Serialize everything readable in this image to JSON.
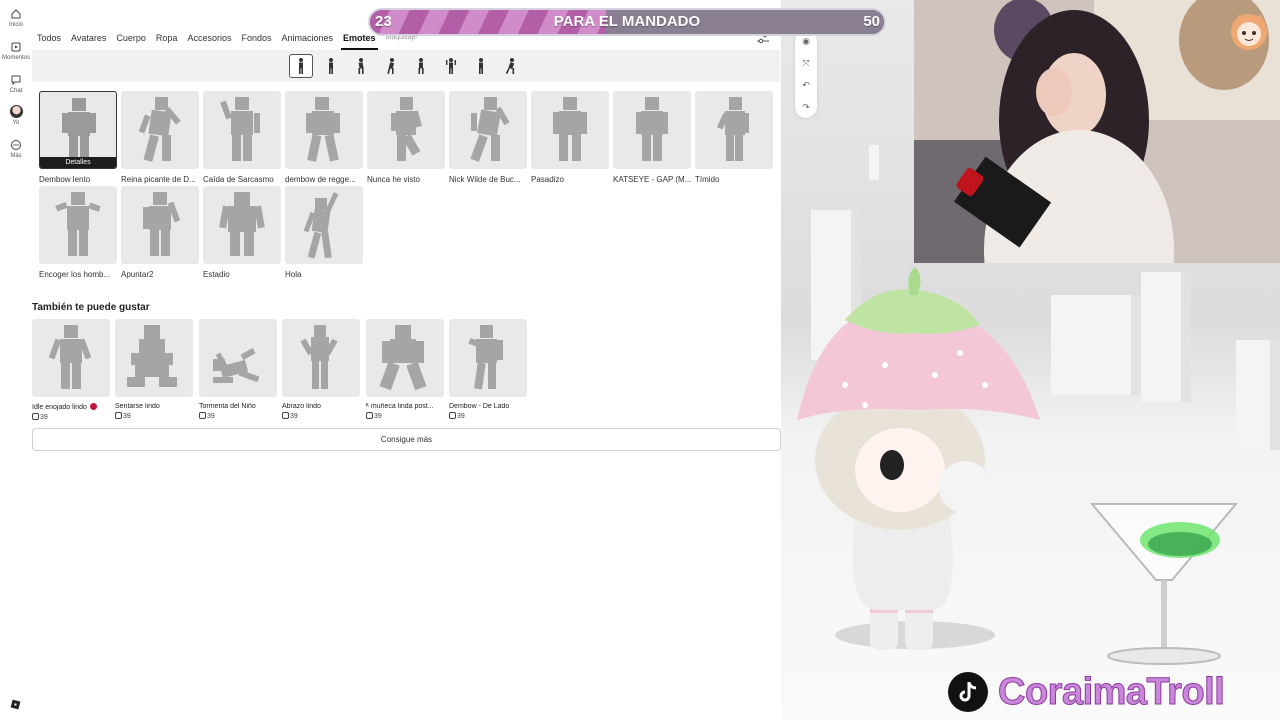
{
  "rail": {
    "items": [
      {
        "label": "Inicio",
        "icon": "home-icon"
      },
      {
        "label": "Momentos",
        "icon": "moments-icon"
      },
      {
        "label": "Chat",
        "icon": "chat-icon"
      },
      {
        "label": "Yo",
        "icon": "avatar"
      },
      {
        "label": "Más",
        "icon": "more-icon"
      }
    ]
  },
  "tabs": [
    {
      "label": "Todos"
    },
    {
      "label": "Avatares"
    },
    {
      "label": "Cuerpo"
    },
    {
      "label": "Ropa"
    },
    {
      "label": "Accesorios"
    },
    {
      "label": "Fondos"
    },
    {
      "label": "Animaciones"
    },
    {
      "label": "Emotes",
      "active": true
    },
    {
      "label": "Maquillaje"
    }
  ],
  "grid": {
    "details_label": "Detalles",
    "items": [
      "Dembow lento",
      "Reina picante de D...",
      "Caída de Sarcasmo",
      "dembow de regge...",
      "Nunca he visto",
      "Nick Wilde de Buc...",
      "Pasadizo",
      "KATSEYE - GAP (M...",
      "Tímido",
      "Encoger los homb...",
      "Apuntar2",
      "Estadio",
      "Hola"
    ]
  },
  "recommend": {
    "title": "También te puede gustar",
    "items": [
      {
        "name": "Idle enojado lindo",
        "price": "39",
        "badge": true
      },
      {
        "name": "Sentarse lindo",
        "price": "39"
      },
      {
        "name": "Tormenta del Niño",
        "price": "39"
      },
      {
        "name": "Abrazo lindo",
        "price": "39"
      },
      {
        "name": "ᴷ muñeca linda post...",
        "price": "39"
      },
      {
        "name": "Dembow - De Lado",
        "price": "39"
      }
    ]
  },
  "more_button": "Consigue más",
  "goal": {
    "current": "23",
    "label": "PARA EL MANDADO",
    "target": "50",
    "progress": 0.46
  },
  "brand": {
    "name": "CoraimaTroll",
    "icon": "tiktok-icon"
  },
  "colors": {
    "accent": "#111111",
    "goal_fill": "#b25fa8",
    "brand": "#c987d9",
    "tile": "#e8e9eb"
  }
}
